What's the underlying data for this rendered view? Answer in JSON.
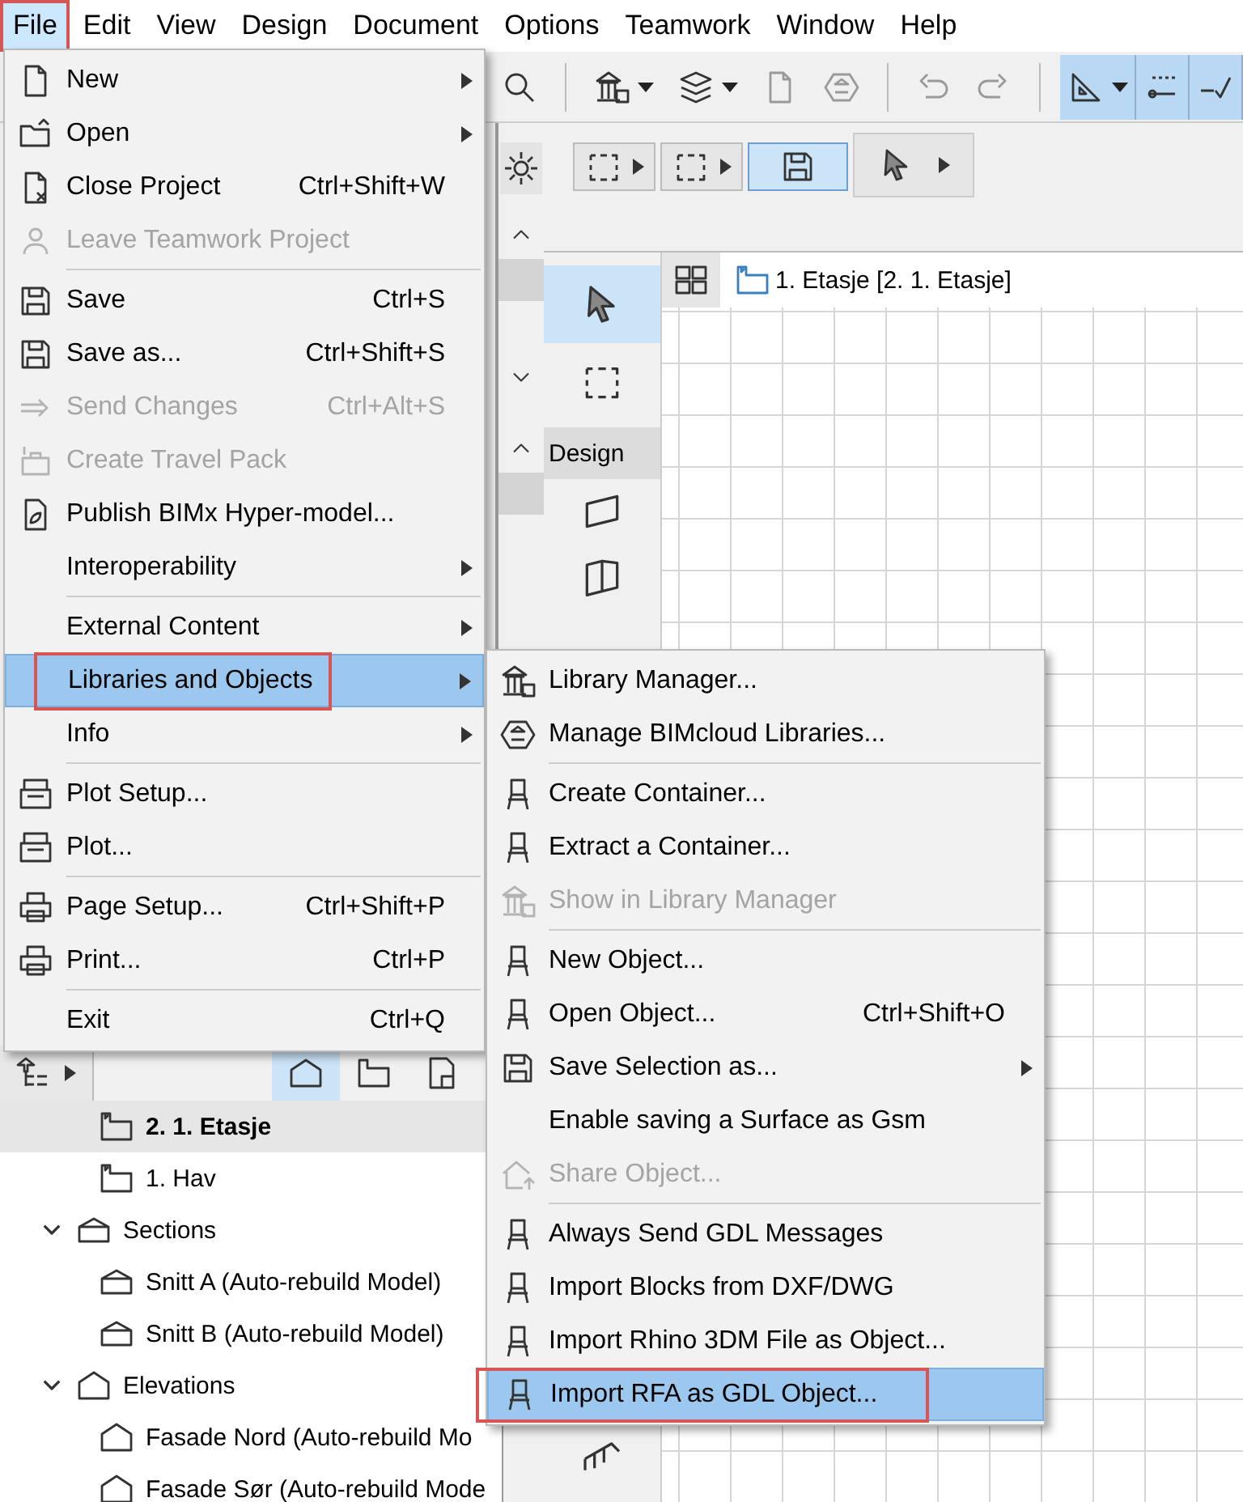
{
  "menubar": [
    {
      "label": "File",
      "selected": true,
      "annotated": true
    },
    {
      "label": "Edit",
      "selected": false,
      "annotated": false
    },
    {
      "label": "View",
      "selected": false,
      "annotated": false
    },
    {
      "label": "Design",
      "selected": false,
      "annotated": false
    },
    {
      "label": "Document",
      "selected": false,
      "annotated": false
    },
    {
      "label": "Options",
      "selected": false,
      "annotated": false
    },
    {
      "label": "Teamwork",
      "selected": false,
      "annotated": false
    },
    {
      "label": "Window",
      "selected": false,
      "annotated": false
    },
    {
      "label": "Help",
      "selected": false,
      "annotated": false
    }
  ],
  "file_menu": {
    "items": [
      {
        "label": "New",
        "disabled": false,
        "submenu": true,
        "selected": false,
        "annotated": false
      },
      {
        "label": "Open",
        "disabled": false,
        "submenu": true,
        "selected": false,
        "annotated": false
      },
      {
        "label": "Close Project",
        "shortcut": "Ctrl+Shift+W",
        "disabled": false,
        "submenu": false,
        "selected": false,
        "annotated": false
      },
      {
        "label": "Leave Teamwork Project",
        "disabled": true,
        "submenu": false,
        "selected": false,
        "annotated": false
      },
      {
        "label": "Save",
        "shortcut": "Ctrl+S",
        "disabled": false,
        "submenu": false,
        "selected": false,
        "annotated": false,
        "separator_before": true
      },
      {
        "label": "Save as...",
        "shortcut": "Ctrl+Shift+S",
        "disabled": false,
        "submenu": false,
        "selected": false,
        "annotated": false
      },
      {
        "label": "Send Changes",
        "shortcut": "Ctrl+Alt+S",
        "disabled": true,
        "submenu": false,
        "selected": false,
        "annotated": false
      },
      {
        "label": "Create Travel Pack",
        "disabled": true,
        "submenu": false,
        "selected": false,
        "annotated": false
      },
      {
        "label": "Publish BIMx Hyper-model...",
        "disabled": false,
        "submenu": false,
        "selected": false,
        "annotated": false
      },
      {
        "label": "Interoperability",
        "disabled": false,
        "submenu": true,
        "selected": false,
        "annotated": false
      },
      {
        "label": "External Content",
        "disabled": false,
        "submenu": true,
        "selected": false,
        "annotated": false,
        "separator_before": true
      },
      {
        "label": "Libraries and Objects",
        "disabled": false,
        "submenu": true,
        "selected": true,
        "annotated": true
      },
      {
        "label": "Info",
        "disabled": false,
        "submenu": true,
        "selected": false,
        "annotated": false
      },
      {
        "label": "Plot Setup...",
        "disabled": false,
        "submenu": false,
        "selected": false,
        "annotated": false,
        "separator_before": true
      },
      {
        "label": "Plot...",
        "disabled": false,
        "submenu": false,
        "selected": false,
        "annotated": false
      },
      {
        "label": "Page Setup...",
        "shortcut": "Ctrl+Shift+P",
        "disabled": false,
        "submenu": false,
        "selected": false,
        "annotated": false,
        "separator_before": true
      },
      {
        "label": "Print...",
        "shortcut": "Ctrl+P",
        "disabled": false,
        "submenu": false,
        "selected": false,
        "annotated": false
      },
      {
        "label": "Exit",
        "shortcut": "Ctrl+Q",
        "disabled": false,
        "submenu": false,
        "selected": false,
        "annotated": false,
        "separator_before": true
      }
    ]
  },
  "libraries_submenu": {
    "items": [
      {
        "label": "Library Manager...",
        "disabled": false,
        "submenu": false,
        "selected": false,
        "annotated": false
      },
      {
        "label": "Manage BIMcloud Libraries...",
        "disabled": false,
        "submenu": false,
        "selected": false,
        "annotated": false
      },
      {
        "label": "Create Container...",
        "disabled": false,
        "submenu": false,
        "selected": false,
        "annotated": false,
        "separator_before": true
      },
      {
        "label": "Extract a Container...",
        "disabled": false,
        "submenu": false,
        "selected": false,
        "annotated": false
      },
      {
        "label": "Show in Library Manager",
        "disabled": true,
        "submenu": false,
        "selected": false,
        "annotated": false
      },
      {
        "label": "New Object...",
        "disabled": false,
        "submenu": false,
        "selected": false,
        "annotated": false,
        "separator_before": true
      },
      {
        "label": "Open Object...",
        "shortcut": "Ctrl+Shift+O",
        "disabled": false,
        "submenu": false,
        "selected": false,
        "annotated": false
      },
      {
        "label": "Save Selection as...",
        "disabled": false,
        "submenu": true,
        "selected": false,
        "annotated": false
      },
      {
        "label": "Enable saving a Surface as Gsm",
        "disabled": false,
        "submenu": false,
        "selected": false,
        "annotated": false
      },
      {
        "label": "Share Object...",
        "disabled": true,
        "submenu": false,
        "selected": false,
        "annotated": false
      },
      {
        "label": "Always Send GDL Messages",
        "disabled": false,
        "submenu": false,
        "selected": false,
        "annotated": false,
        "separator_before": true
      },
      {
        "label": "Import Blocks from DXF/DWG",
        "disabled": false,
        "submenu": false,
        "selected": false,
        "annotated": false
      },
      {
        "label": "Import Rhino 3DM File as Object...",
        "disabled": false,
        "submenu": false,
        "selected": false,
        "annotated": false
      },
      {
        "label": "Import RFA as GDL Object...",
        "disabled": false,
        "submenu": false,
        "selected": true,
        "annotated": true
      }
    ]
  },
  "palette": {
    "heading": "Design"
  },
  "canvas": {
    "tab": "1. Etasje [2. 1. Etasje]"
  },
  "navigator": {
    "tree": [
      {
        "children": [
          {
            "label": "2. 1. Etasje",
            "kind": "story",
            "selected": true
          },
          {
            "label": "1. Hav",
            "kind": "story",
            "selected": false
          }
        ]
      },
      {
        "label": "Sections",
        "kind": "section",
        "expanded": true,
        "selected": false,
        "children": [
          {
            "label": "Snitt A (Auto-rebuild Model)",
            "kind": "section",
            "selected": false
          },
          {
            "label": "Snitt B (Auto-rebuild Model)",
            "kind": "section",
            "selected": false
          }
        ]
      },
      {
        "label": "Elevations",
        "kind": "elevation",
        "expanded": true,
        "selected": false,
        "children": [
          {
            "label": "Fasade Nord (Auto-rebuild Mo",
            "kind": "elevation",
            "selected": false
          },
          {
            "label": "Fasade Sør (Auto-rebuild Mode",
            "kind": "elevation",
            "selected": false
          }
        ]
      }
    ]
  }
}
